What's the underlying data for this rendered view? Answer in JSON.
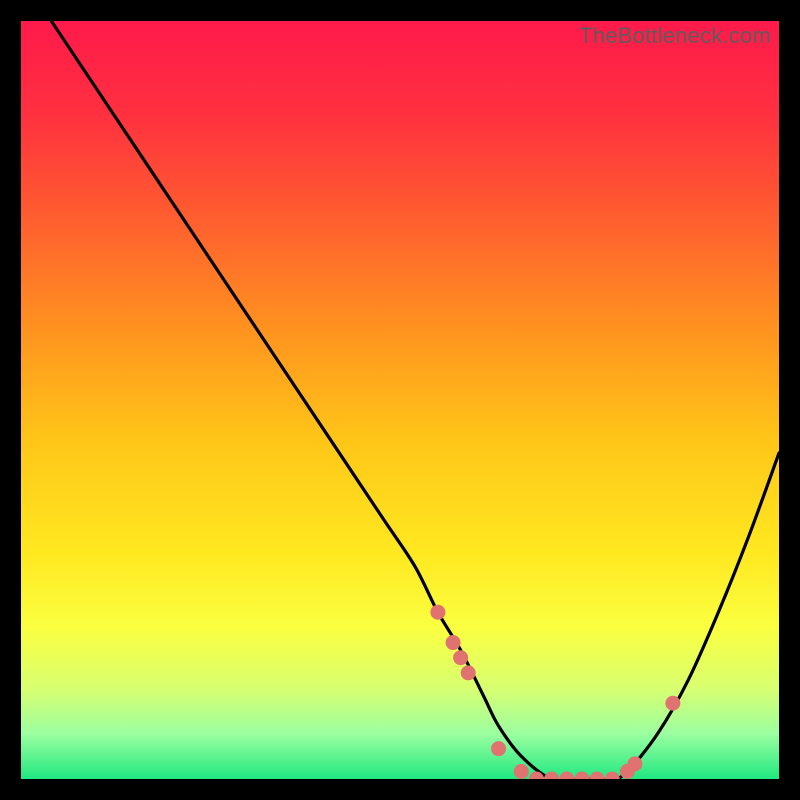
{
  "watermark": "TheBottleneck.com",
  "colors": {
    "dot": "#e0736f",
    "curve": "#000000",
    "gradient_stops": [
      {
        "offset": 0.0,
        "color": "#ff1a4b"
      },
      {
        "offset": 0.12,
        "color": "#ff3040"
      },
      {
        "offset": 0.25,
        "color": "#ff5a30"
      },
      {
        "offset": 0.4,
        "color": "#ff9020"
      },
      {
        "offset": 0.55,
        "color": "#ffc518"
      },
      {
        "offset": 0.7,
        "color": "#ffe820"
      },
      {
        "offset": 0.8,
        "color": "#faff40"
      },
      {
        "offset": 0.88,
        "color": "#d8ff70"
      },
      {
        "offset": 0.94,
        "color": "#9cffa0"
      },
      {
        "offset": 1.0,
        "color": "#20e880"
      }
    ]
  },
  "chart_data": {
    "type": "line",
    "title": "",
    "xlabel": "",
    "ylabel": "",
    "xlim": [
      0,
      100
    ],
    "ylim": [
      0,
      100
    ],
    "series": [
      {
        "name": "bottleneck-curve",
        "x": [
          4,
          8,
          12,
          16,
          20,
          24,
          28,
          32,
          36,
          40,
          44,
          48,
          52,
          55,
          58,
          61,
          63,
          66,
          70,
          74,
          78,
          80,
          84,
          88,
          92,
          96,
          100
        ],
        "y": [
          100,
          94,
          88,
          82,
          76,
          70,
          64,
          58,
          52,
          46,
          40,
          34,
          28,
          22,
          17,
          11,
          7,
          3,
          0,
          0,
          0,
          1,
          6,
          13,
          22,
          32,
          43
        ]
      }
    ],
    "markers": {
      "name": "highlight-dots",
      "x": [
        55,
        57,
        58,
        59,
        63,
        66,
        68,
        70,
        72,
        74,
        76,
        78,
        80,
        81,
        86
      ],
      "y": [
        22,
        18,
        16,
        14,
        4,
        1,
        0,
        0,
        0,
        0,
        0,
        0,
        1,
        2,
        10
      ]
    }
  }
}
